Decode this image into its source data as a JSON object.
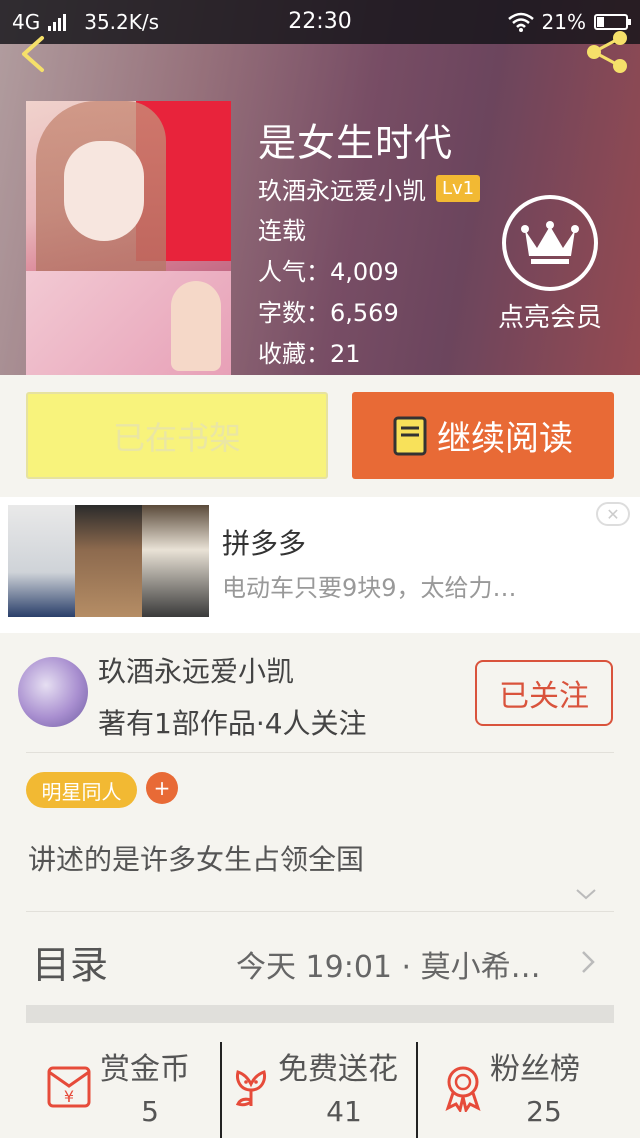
{
  "status_bar": {
    "network": "4G",
    "speed": "35.2K/s",
    "time": "22:30",
    "battery": "21%"
  },
  "book": {
    "title": "是女生时代",
    "author": "玖酒永远爱小凯",
    "level": "Lv1",
    "status": "连载",
    "popularity_label": "人气：",
    "popularity": "4,009",
    "words_label": "字数：",
    "words": "6,569",
    "favorites_label": "收藏：",
    "favorites": "21",
    "member_label": "点亮会员"
  },
  "actions": {
    "shelf_label": "已在书架",
    "read_label": "继续阅读"
  },
  "ad": {
    "title": "拼多多",
    "description": "电动车只要9块9，太给力…",
    "close": "✕"
  },
  "author_card": {
    "name": "玖酒永远爱小凯",
    "works": "著有1部作品·4人关注",
    "follow_label": "已关注"
  },
  "tags": {
    "items": [
      "明星同人"
    ],
    "add": "+"
  },
  "intro": "讲述的是许多女生占领全国",
  "toc": {
    "label": "目录",
    "latest": "今天 19:01 · 莫小希…"
  },
  "stats": [
    {
      "label": "赏金币",
      "value": "5",
      "icon": "coin-envelope-icon"
    },
    {
      "label": "免费送花",
      "value": "41",
      "icon": "flower-icon"
    },
    {
      "label": "粉丝榜",
      "value": "25",
      "icon": "medal-icon"
    }
  ],
  "colors": {
    "accent": "#e86a36",
    "badge": "#f2b933",
    "follow": "#d9533c",
    "shelf": "#f8f37c"
  }
}
